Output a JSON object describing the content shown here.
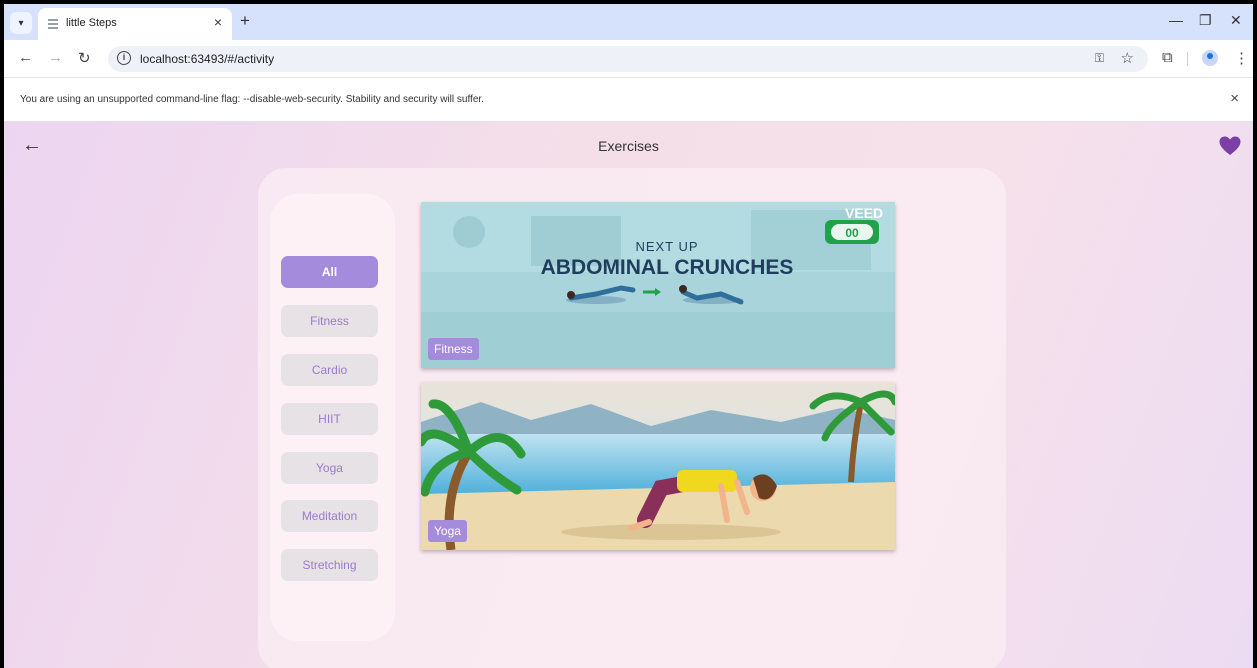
{
  "browser": {
    "tab_title": "little Steps",
    "tab_close": "×",
    "new_tab": "+",
    "url": "localhost:63493/#/activity",
    "infobar_message": "You are using an unsupported command-line flag: --disable-web-security. Stability and security will suffer.",
    "infobar_close": "×"
  },
  "app": {
    "title": "Exercises",
    "back_icon": "←",
    "favorite_color": "#7b3fa8",
    "accent_color": "#a58bdb"
  },
  "filters": [
    {
      "label": "All",
      "active": true
    },
    {
      "label": "Fitness",
      "active": false
    },
    {
      "label": "Cardio",
      "active": false
    },
    {
      "label": "HIIT",
      "active": false
    },
    {
      "label": "Yoga",
      "active": false
    },
    {
      "label": "Meditation",
      "active": false
    },
    {
      "label": "Stretching",
      "active": false
    }
  ],
  "videos": [
    {
      "category": "Fitness",
      "overlay_small": "NEXT UP",
      "overlay_large": "ABDOMINAL CRUNCHES",
      "watermark": "VEED",
      "counter": "00"
    },
    {
      "category": "Yoga"
    }
  ]
}
